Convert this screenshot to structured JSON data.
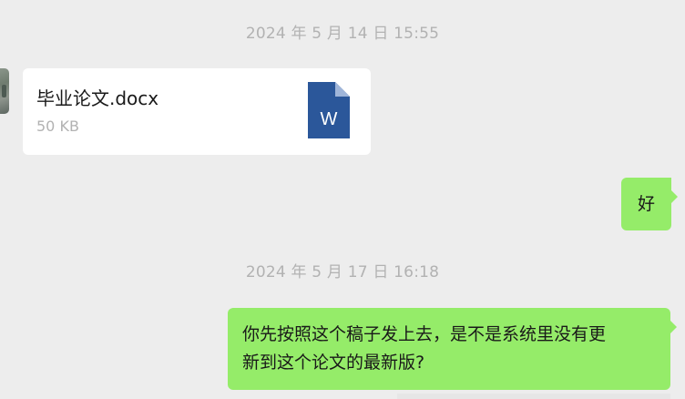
{
  "timestamps": {
    "first": "2024 年 5 月 14 日 15:55",
    "second": "2024 年 5 月 17 日 16:18"
  },
  "file_message": {
    "filename": "毕业论文.docx",
    "size": "50 KB",
    "icon": "word-document-icon",
    "icon_letter": "W",
    "icon_color": "#2b579a"
  },
  "messages": [
    {
      "sender": "me",
      "text": "好"
    },
    {
      "sender": "me",
      "text": "你先按照这个稿子发上去，是不是系统里没有更\n新到这个论文的最新版?"
    }
  ],
  "colors": {
    "background": "#ededed",
    "outgoing_bubble": "#95ec69",
    "incoming_card": "#ffffff",
    "timestamp_text": "#b2b2b2"
  }
}
